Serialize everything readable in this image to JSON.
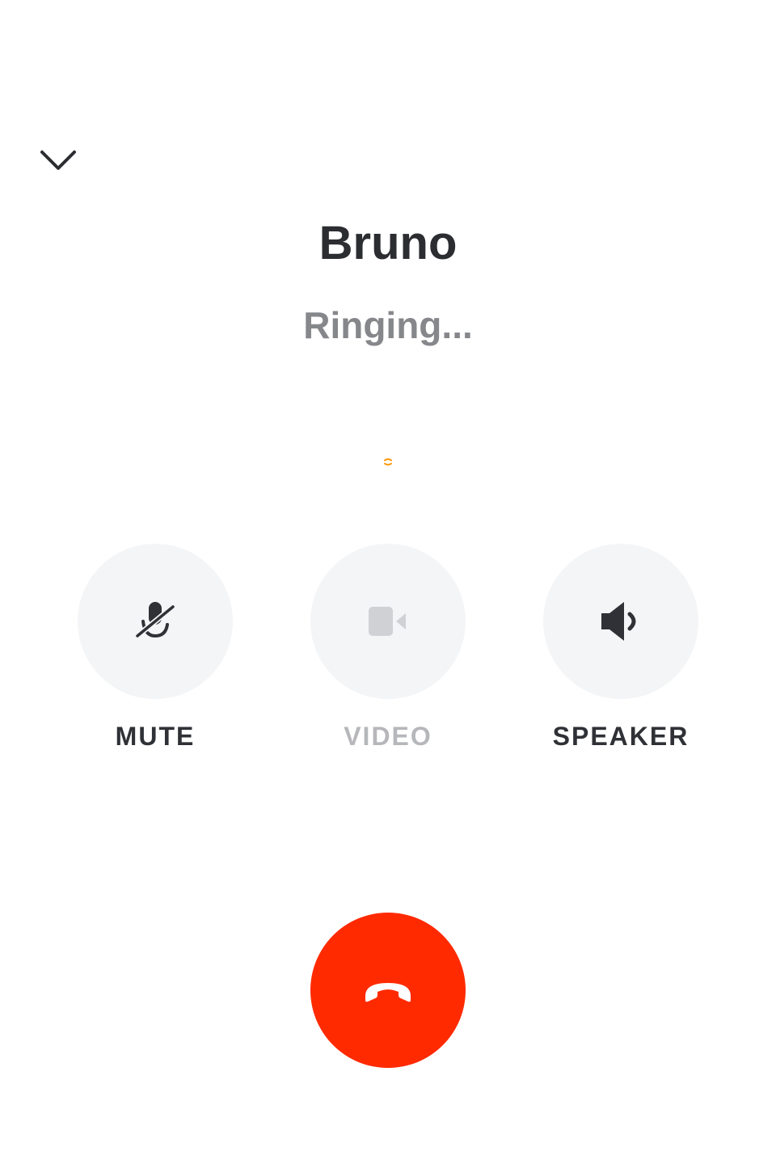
{
  "call": {
    "contact_name": "Bruno",
    "status": "Ringing..."
  },
  "controls": {
    "mute_label": "MUTE",
    "video_label": "VIDEO",
    "speaker_label": "SPEAKER"
  },
  "icons": {
    "collapse": "chevron-down-icon",
    "mute": "microphone-off-icon",
    "video": "video-camera-icon",
    "speaker": "speaker-icon",
    "end_call": "phone-hangup-icon"
  },
  "colors": {
    "end_call": "#ff2a00",
    "control_bg": "#f4f5f7",
    "text_dark": "#2b2d31",
    "text_muted": "#85878b",
    "ringing_accent": "#ff9500"
  }
}
